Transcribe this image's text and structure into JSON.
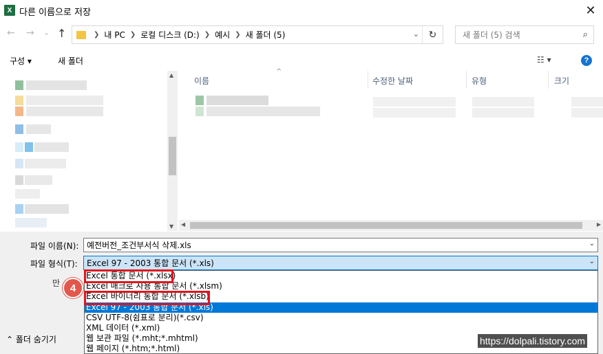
{
  "window": {
    "app_icon": "X",
    "title": "다른 이름으로 저장",
    "close_icon": "✕"
  },
  "nav": {
    "back_icon": "←",
    "forward_icon": "→",
    "recent_icon": "⌄",
    "up_icon": "↑"
  },
  "address": {
    "crumbs": [
      "내 PC",
      "로컬 디스크 (D:)",
      "예시",
      "새 폴더 (5)"
    ],
    "dropdown_icon": "⌄",
    "refresh_icon": "↻"
  },
  "search": {
    "placeholder": "새 폴더 (5) 검색",
    "icon": "⌕"
  },
  "toolbar": {
    "organize_label": "구성 ▾",
    "new_folder_label": "새 폴더",
    "view_label": "☷ ▾",
    "help_label": "?"
  },
  "filelist": {
    "columns": [
      "이름",
      "수정한 날짜",
      "유형",
      "크기"
    ],
    "sort_indicator": "^"
  },
  "form": {
    "filename_label": "파일 이름(N):",
    "filename_value": "예전버전_조건부서식 삭제.xls",
    "filetype_label": "파일 형식(T):",
    "filetype_value": "Excel 97 - 2003 통합 문서 (*.xls)",
    "author_label": "만"
  },
  "filetype_options": [
    "Excel 통합 문서 (*.xlsx)",
    "Excel 매크로 사용 통합 문서 (*.xlsm)",
    "Excel 바이너리 통합 문서 (*.xlsb)",
    "Excel 97 - 2003 통합 문서 (*.xls)",
    "CSV UTF-8(쉼표로 분리)(*.csv)",
    "XML 데이터 (*.xml)",
    "웹 보관 파일 (*.mht;*.mhtml)",
    "웹 페이지 (*.htm;*.html)"
  ],
  "selected_option_index": 3,
  "annotation": {
    "step_badge": "4",
    "highlight_color": "#e0141e",
    "badge_color": "#e2574c"
  },
  "footer": {
    "hide_folders_label": "⌃  폴더 숨기기"
  },
  "watermark": "https://dolpali.tistory.com",
  "colors": {
    "accent": "#0078d7",
    "selection_bg": "#cce4f7",
    "excel_green": "#1d6f42"
  }
}
